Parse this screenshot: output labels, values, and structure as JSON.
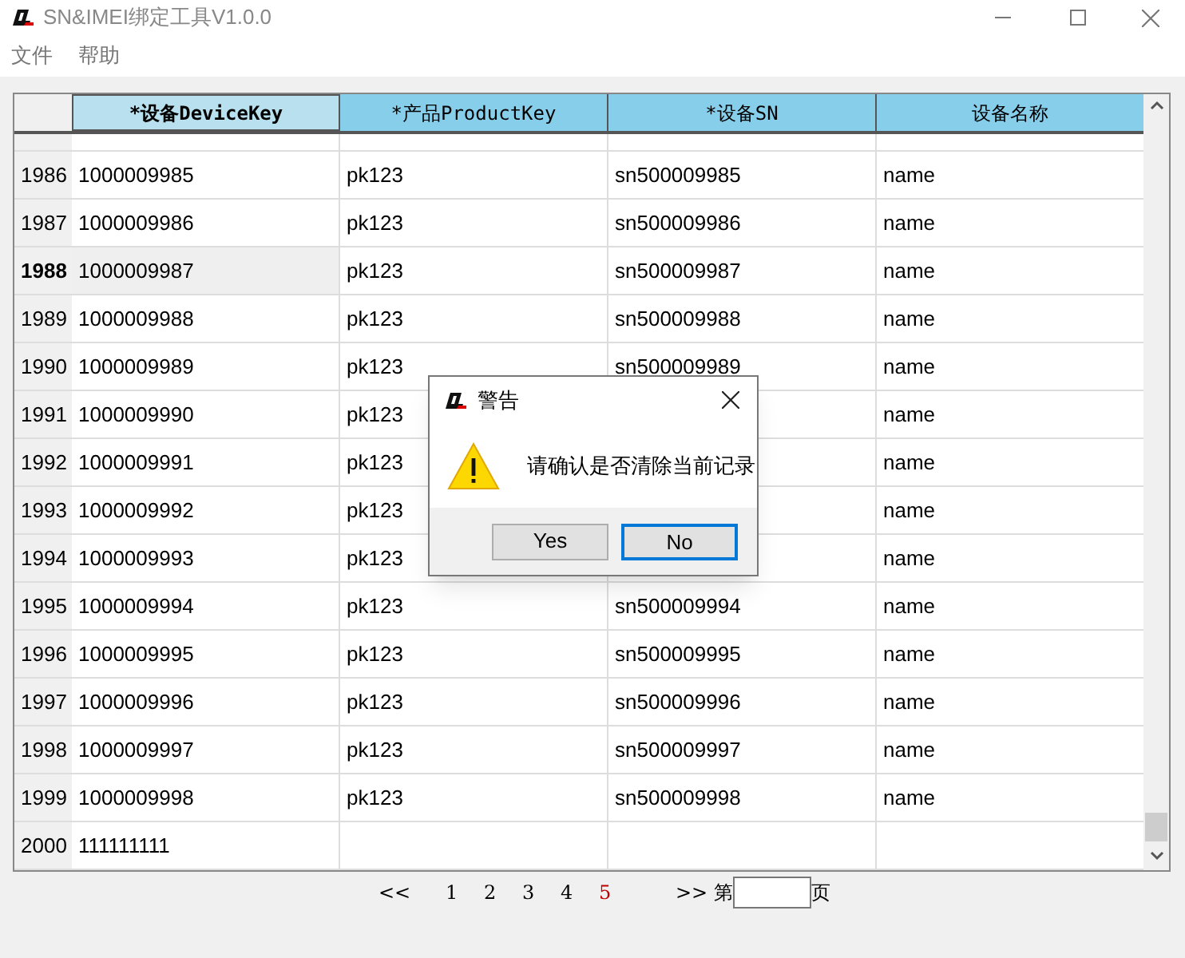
{
  "window": {
    "title": "SN&IMEI绑定工具V1.0.0"
  },
  "menu": [
    "文件",
    "帮助"
  ],
  "table": {
    "columns": [
      {
        "label": "*设备DeviceKey",
        "selected": true
      },
      {
        "label": "*产品ProductKey",
        "selected": false
      },
      {
        "label": "*设备SN",
        "selected": false
      },
      {
        "label": "设备名称",
        "selected": false
      }
    ],
    "rows": [
      {
        "number": "1986",
        "cells": [
          "1000009985",
          "pk123",
          "sn500009985",
          "name"
        ],
        "selected": false
      },
      {
        "number": "1987",
        "cells": [
          "1000009986",
          "pk123",
          "sn500009986",
          "name"
        ],
        "selected": false
      },
      {
        "number": "1988",
        "cells": [
          "1000009987",
          "pk123",
          "sn500009987",
          "name"
        ],
        "selected": true
      },
      {
        "number": "1989",
        "cells": [
          "1000009988",
          "pk123",
          "sn500009988",
          "name"
        ],
        "selected": false
      },
      {
        "number": "1990",
        "cells": [
          "1000009989",
          "pk123",
          "sn500009989",
          "name"
        ],
        "selected": false
      },
      {
        "number": "1991",
        "cells": [
          "1000009990",
          "pk123",
          "",
          "name"
        ],
        "selected": false
      },
      {
        "number": "1992",
        "cells": [
          "1000009991",
          "pk123",
          "",
          "name"
        ],
        "selected": false
      },
      {
        "number": "1993",
        "cells": [
          "1000009992",
          "pk123",
          "",
          "name"
        ],
        "selected": false
      },
      {
        "number": "1994",
        "cells": [
          "1000009993",
          "pk123",
          "",
          "name"
        ],
        "selected": false
      },
      {
        "number": "1995",
        "cells": [
          "1000009994",
          "pk123",
          "sn500009994",
          "name"
        ],
        "selected": false
      },
      {
        "number": "1996",
        "cells": [
          "1000009995",
          "pk123",
          "sn500009995",
          "name"
        ],
        "selected": false
      },
      {
        "number": "1997",
        "cells": [
          "1000009996",
          "pk123",
          "sn500009996",
          "name"
        ],
        "selected": false
      },
      {
        "number": "1998",
        "cells": [
          "1000009997",
          "pk123",
          "sn500009997",
          "name"
        ],
        "selected": false
      },
      {
        "number": "1999",
        "cells": [
          "1000009998",
          "pk123",
          "sn500009998",
          "name"
        ],
        "selected": false
      },
      {
        "number": "2000",
        "cells": [
          "111111111",
          "",
          "",
          ""
        ],
        "selected": false
      }
    ]
  },
  "pagination": {
    "first": "<<",
    "pages": [
      {
        "label": "1",
        "selected": false
      },
      {
        "label": "2",
        "selected": false
      },
      {
        "label": "3",
        "selected": false
      },
      {
        "label": "4",
        "selected": false
      },
      {
        "label": "5",
        "selected": true
      }
    ],
    "last": ">>",
    "prefix": "第",
    "suffix": "页"
  },
  "dialog": {
    "title": "警告",
    "message": "请确认是否清除当前记录",
    "buttons": [
      {
        "label": "Yes",
        "selected": false
      },
      {
        "label": "No",
        "selected": true
      }
    ]
  }
}
